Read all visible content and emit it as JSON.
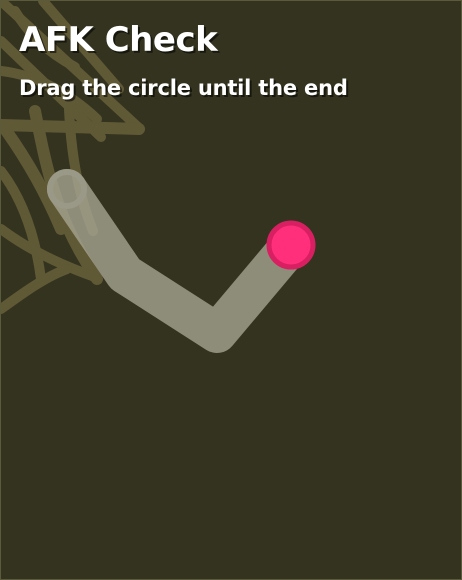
{
  "game": {
    "title": "AFK Check",
    "instruction": "Drag the circle until the end"
  },
  "colors": {
    "background": "#33331f",
    "web": "#8f834d",
    "path": "#a8a795",
    "start_marker": "#9a9987",
    "handle_fill": "#ff2f7b",
    "handle_ring": "#d81f62"
  },
  "icons": {
    "decoration": "spider-web-icon",
    "start": "start-ring-icon",
    "handle": "drag-handle-icon"
  }
}
